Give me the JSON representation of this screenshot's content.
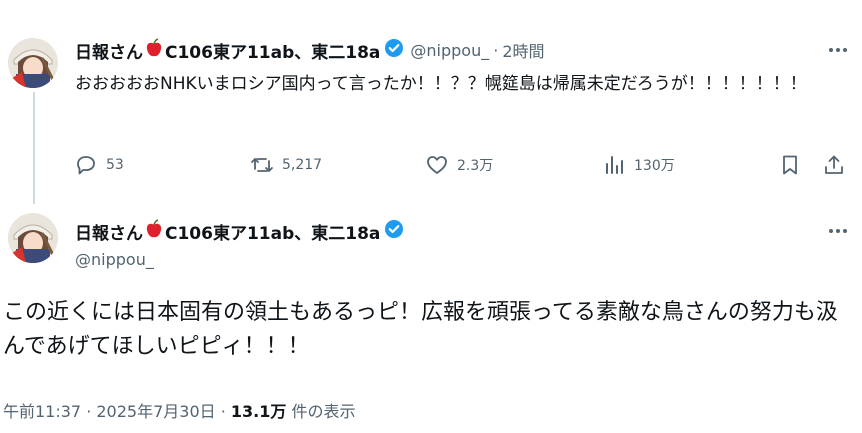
{
  "reply_tweet": {
    "display_name": "日報さん",
    "name_suffix": "C106東ア11ab、東二18a",
    "handle": "@nippou_",
    "separator": "·",
    "time": "2時間",
    "text": "おおおおおNHKいまロシア国内って言ったか！！？？幌筵島は帰属未定だろうが！！！！！！！",
    "actions": {
      "replies": "53",
      "reposts": "5,217",
      "likes": "2.3万",
      "views": "130万"
    }
  },
  "main_tweet": {
    "display_name": "日報さん",
    "name_suffix": "C106東ア11ab、東二18a",
    "handle": "@nippou_",
    "text": "この近くには日本固有の領土もあるっピ！広報を頑張ってる素敵な鳥さんの努力も汲んであげてほしいピピィ！！！",
    "timestamp": "午前11:37 · 2025年7月30日 · ",
    "view_count": "13.1万",
    "view_label": " 件の表示"
  },
  "icons": {
    "more": "more-icon",
    "reply": "reply-icon",
    "repost": "repost-icon",
    "like": "like-icon",
    "views": "views-icon",
    "bookmark": "bookmark-icon",
    "share": "share-icon",
    "verified": "verified-badge-icon",
    "apple": "red-apple-emoji"
  },
  "colors": {
    "text": "#0f1419",
    "secondary": "#536471",
    "verified": "#1d9bf0",
    "apple": "#e0202b",
    "thread_line": "#cfd9de"
  }
}
